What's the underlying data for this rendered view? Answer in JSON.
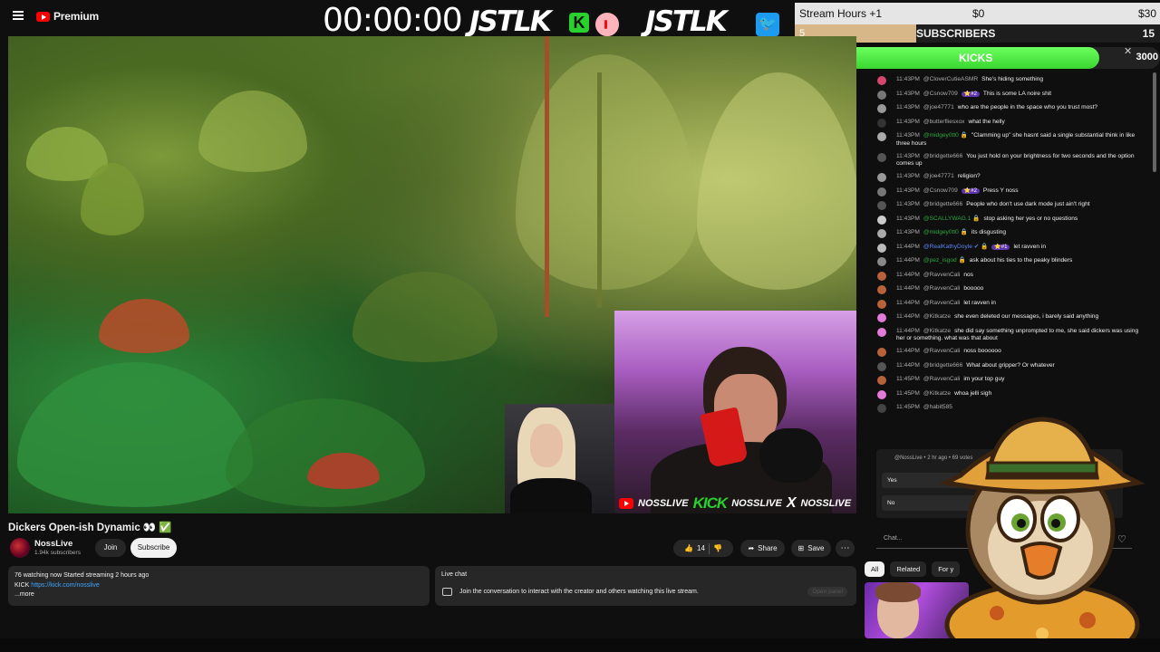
{
  "app": {
    "brand": "Premium"
  },
  "overlay": {
    "timer": "00:00:00",
    "brand_left": "JSTLK",
    "brand_right": "JSTLK",
    "kick_letter": "K",
    "twitter_glyph": "🐦",
    "goal": {
      "label": "Stream Hours +1",
      "start": "$0",
      "end": "$30"
    },
    "subscribers": {
      "current": "5",
      "label": "SUBSCRIBERS",
      "goal": "15",
      "progress": 0.333
    },
    "kicks": {
      "current": "2510",
      "label": "KICKS",
      "goal": "3000",
      "progress": 0.837
    },
    "social": {
      "handle1": "NOSSLIVE",
      "kick": "KICK",
      "handle2": "NOSSLIVE",
      "x": "X",
      "handle3": "NOSSLIVE"
    },
    "colors": {
      "kick_green": "#29d12d",
      "twitter_blue": "#1d9bf0",
      "youtube_red": "#ff0000",
      "goal_tan": "#d7b787"
    }
  },
  "video": {
    "title": "Dickers Open-ish Dynamic 👀 ✅",
    "channel": "NossLive",
    "subscribers": "1.94k subscribers",
    "join": "Join",
    "subscribe": "Subscribe",
    "likes": "14",
    "share": "Share",
    "save": "Save",
    "more": "⋯"
  },
  "description": {
    "line1": "76 watching now  Started streaming 2 hours ago",
    "kick_prefix": "KICK ",
    "kick_link": "https://kick.com/nosslive",
    "more": "...more"
  },
  "livechat": {
    "label": "Live chat",
    "message": "Join the conversation to interact with the creator and others watching this live stream.",
    "open_panel": "Open panel"
  },
  "chat": {
    "messages": [
      {
        "time": "11:43PM",
        "user": "@CloverCutieASMR",
        "text": "She's hiding something",
        "avatar": "#d4476f"
      },
      {
        "time": "11:43PM",
        "user": "@Csnow709",
        "badge": "⭐#2",
        "text": "This is some LA noire shit",
        "avatar": "#777"
      },
      {
        "time": "11:43PM",
        "user": "@joe47771",
        "text": "who are the people in the space who you trust most?",
        "avatar": "#999"
      },
      {
        "time": "11:43PM",
        "user": "@butterfliesxox",
        "text": "what the helly",
        "avatar": "#333"
      },
      {
        "time": "11:43PM",
        "user": "@midgey0tt0 🔒",
        "mod": true,
        "text": "\"Clamming up\" she hasnt said a single substantial think in like three hours",
        "avatar": "#aaa"
      },
      {
        "time": "11:43PM",
        "user": "@bridgette666",
        "text": "You just hold on your brightness for two seconds and the option comes up",
        "avatar": "#555"
      },
      {
        "time": "11:43PM",
        "user": "@joe47771",
        "text": "religion?",
        "avatar": "#999"
      },
      {
        "time": "11:43PM",
        "user": "@Csnow709",
        "badge": "⭐#2",
        "text": "Press Y noss",
        "avatar": "#777"
      },
      {
        "time": "11:43PM",
        "user": "@bridgette666",
        "text": "People who don't use dark mode just ain't right",
        "avatar": "#555"
      },
      {
        "time": "11:43PM",
        "user": "@SCALLYWAG.1 🔒",
        "mod": true,
        "text": "stop asking her yes or no questions",
        "avatar": "#ccc"
      },
      {
        "time": "11:43PM",
        "user": "@midgey0tt0 🔒",
        "mod": true,
        "text": "its disgusting",
        "avatar": "#aaa"
      },
      {
        "time": "11:44PM",
        "user": "@RealKathyDoyle ✔ 🔒",
        "verified": true,
        "badge": "⭐#1",
        "text": "let ravven in",
        "avatar": "#bbb"
      },
      {
        "time": "11:44PM",
        "user": "@pez_isgod 🔒",
        "mod": true,
        "text": "ask about his ties to the peaky blinders",
        "avatar": "#888"
      },
      {
        "time": "11:44PM",
        "user": "@RavvenCali",
        "text": "nos",
        "avatar": "#b8623b"
      },
      {
        "time": "11:44PM",
        "user": "@RavvenCali",
        "text": "booooo",
        "avatar": "#b8623b"
      },
      {
        "time": "11:44PM",
        "user": "@RavvenCali",
        "text": "let ravven in",
        "avatar": "#b8623b"
      },
      {
        "time": "11:44PM",
        "user": "@Kitkatze",
        "text": "she even deleted our messages, i barely said anything",
        "avatar": "#e27ad8"
      },
      {
        "time": "11:44PM",
        "user": "@Kitkatze",
        "text": "she did say something unprompted to me, she said dickers was using her or something. what was that about",
        "avatar": "#e27ad8"
      },
      {
        "time": "11:44PM",
        "user": "@RavvenCali",
        "text": "noss boooooo",
        "avatar": "#b8623b"
      },
      {
        "time": "11:44PM",
        "user": "@bridgette666",
        "text": "What about gripper? Or whatever",
        "avatar": "#555"
      },
      {
        "time": "11:45PM",
        "user": "@RavvenCali",
        "text": "im your top guy",
        "avatar": "#b8623b"
      },
      {
        "time": "11:45PM",
        "user": "@Kitkatze",
        "text": "whoa jelli sigh",
        "avatar": "#e27ad8"
      },
      {
        "time": "11:45PM",
        "user": "@habit585",
        "text": "",
        "avatar": "#444"
      }
    ],
    "poll": {
      "header": "@NossLive • 2 hr ago • 69 votes",
      "yes": "Yes",
      "no": "No"
    },
    "input_placeholder": "Chat...",
    "heart": "♡"
  },
  "related": {
    "chips": [
      "All",
      "Related",
      "For y"
    ]
  }
}
